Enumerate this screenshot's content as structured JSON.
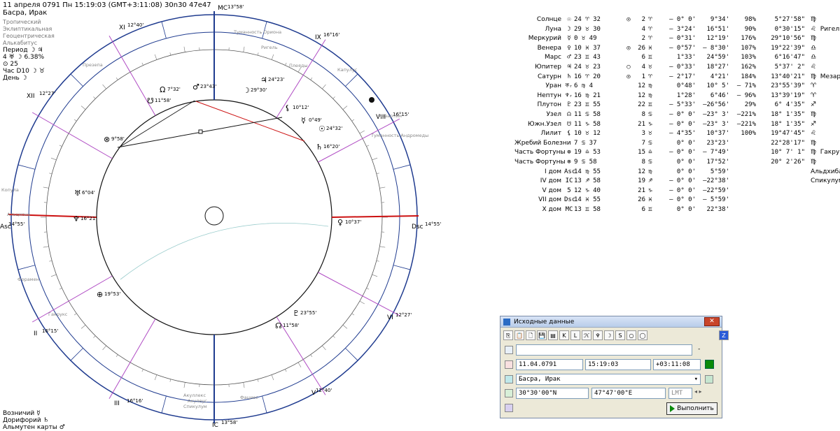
{
  "header": {
    "line1": "11 апреля 0791  Пн  15:19:03 (GMT+3:11:08) 30n30  47e47",
    "line2": "Басра, Ирак"
  },
  "info": {
    "zodiac": "Тропический",
    "coords": "Эклиптикальная",
    "center": "Геоцентрическая",
    "house": "Алькабитус",
    "period_label": "Период",
    "period_glyphs": "☽ ♃",
    "phase_line": "4 ♅ ☽ 6.38%",
    "day_num_line": "⊙ 25",
    "hour_label": "Час D10",
    "hour_glyphs": "☽ ♉",
    "day_label": "День",
    "day_glyph": "☽"
  },
  "bottom": {
    "vozn": "Возничий ☿",
    "dorif": "Дорифорий ♄",
    "almuten": "Альмутен карты ♂"
  },
  "chart_labels": {
    "mc": "MC",
    "mc_deg": "13°58'",
    "ic": "IC",
    "ic_deg": "13°58'",
    "asc": "Asc",
    "asc_deg": "14°55'",
    "dsc": "Dsc",
    "dsc_deg": "14°55'",
    "cusps": [
      {
        "name": "XI",
        "deg": "12°40'"
      },
      {
        "name": "XII",
        "deg": "12°27'"
      },
      {
        "name": "IX",
        "deg": "16°16'"
      },
      {
        "name": "VIII",
        "deg": "16°15'"
      },
      {
        "name": "II",
        "deg": "16°15'"
      },
      {
        "name": "III",
        "deg": "16°16'"
      },
      {
        "name": "VI",
        "deg": "12°27'"
      },
      {
        "name": "V",
        "deg": "12°40'"
      }
    ],
    "stars": [
      "Туманность Ориона",
      "Ригель",
      "Плеяды",
      "Капулус",
      "Мезартим",
      "Туманность Андромеды",
      "Копула",
      "Альциона",
      "Форамен",
      "Гакрукс",
      "Акуллекс",
      "Акулеус",
      "Спикулум",
      "Фациес",
      "Презепа",
      "Альдхиба"
    ],
    "planets": [
      {
        "g": "☉",
        "deg": "24°32'"
      },
      {
        "g": "☽",
        "deg": "29°30'"
      },
      {
        "g": "☿",
        "deg": "0°49'"
      },
      {
        "g": "♀",
        "deg": "10°37'"
      },
      {
        "g": "♂",
        "deg": "23°43'"
      },
      {
        "g": "♃",
        "deg": "24°23'"
      },
      {
        "g": "♄",
        "deg": "16°20'"
      },
      {
        "g": "♅",
        "deg": "6°04'"
      },
      {
        "g": "♆",
        "deg": "16°21'"
      },
      {
        "g": "♇",
        "deg": "23°55'"
      },
      {
        "g": "☊",
        "deg": "11°58'"
      },
      {
        "g": "☋",
        "deg": "11°58'"
      },
      {
        "g": "⚸",
        "deg": "10°12'"
      },
      {
        "g": "⊗",
        "deg": "9°58'"
      },
      {
        "g": "⊕",
        "deg": "19°53'"
      },
      {
        "g": "Ω",
        "deg": "7°32'"
      }
    ]
  },
  "table": {
    "rows": [
      {
        "name": "Солнце",
        "sym": "☉",
        "pos": "24 ♈ 32",
        "g1": "◎",
        "h": "2",
        "g2": "♈",
        "lat": "– 0° 0'",
        "speed": "9°34'",
        "pct": "98%",
        "dec": "5°27'58\"",
        "star": "♍"
      },
      {
        "name": "Луна",
        "sym": "☽",
        "pos": "29 ♉ 30",
        "g1": "",
        "h": "4",
        "g2": "♈",
        "lat": "– 3°24'",
        "speed": "16°51'",
        "pct": "90%",
        "dec": "0°30'15\"",
        "star": "♌  Ригель"
      },
      {
        "name": "Меркурий",
        "sym": "☿",
        "pos": "0 ♉ 49",
        "g1": "",
        "h": "2",
        "g2": "♈",
        "lat": "– 0°31'",
        "speed": "12°19'",
        "pct": "176%",
        "dec": "29°10'56\"",
        "star": "♍"
      },
      {
        "name": "Венера",
        "sym": "♀",
        "pos": "10 ♓ 37",
        "g1": "◎",
        "h": "26",
        "g2": "♓",
        "lat": "– 0°57'",
        "speed": "– 8°30'",
        "pct": "107%",
        "dec": "19°22'39\"",
        "star": "♎"
      },
      {
        "name": "Марс",
        "sym": "♂",
        "pos": "23 ♊ 43",
        "g1": "",
        "h": "6",
        "g2": "♊",
        "lat": "1°33'",
        "speed": "24°59'",
        "pct": "103%",
        "dec": "6°16'47\"",
        "star": "♎"
      },
      {
        "name": "Юпитер",
        "sym": "♃",
        "pos": "24 ♉ 23",
        "g1": "○",
        "h": "4",
        "g2": "♉",
        "lat": "– 0°33'",
        "speed": "18°27'",
        "pct": "162%",
        "dec": "5°37' 2\"",
        "star": "♌"
      },
      {
        "name": "Сатурн",
        "sym": "♄",
        "pos": "16 ♈ 20",
        "g1": "◎",
        "h": "1",
        "g2": "♈",
        "lat": "– 2°17'",
        "speed": "4°21'",
        "pct": "184%",
        "dec": "13°40'21\"",
        "star": "♍  Мезартим"
      },
      {
        "name": "Уран",
        "sym": "♅ᵣ",
        "pos": "6 ♍ 4",
        "g1": "",
        "h": "12",
        "g2": "♍",
        "lat": "0°48'",
        "speed": "10° 5'",
        "pct": "– 71%",
        "dec": "23°55'39\"",
        "star": "♈"
      },
      {
        "name": "Нептун",
        "sym": "♆ᵣ",
        "pos": "16 ♍ 21",
        "g1": "",
        "h": "12",
        "g2": "♍",
        "lat": "1°28'",
        "speed": "6°46'",
        "pct": "– 96%",
        "dec": "13°39'19\"",
        "star": "♈"
      },
      {
        "name": "Плутон",
        "sym": "♇",
        "pos": "23 ♊ 55",
        "g1": "",
        "h": "22",
        "g2": "♊",
        "lat": "– 5°33'",
        "speed": "–26°56'",
        "pct": "29%",
        "dec": "6° 4'35\"",
        "star": "♐"
      },
      {
        "name": "Узел",
        "sym": "☊",
        "pos": "11 ♋ 58",
        "g1": "",
        "h": "8",
        "g2": "♋",
        "lat": "– 0° 0'",
        "speed": "–23° 3'",
        "pct": "–221%",
        "dec": "18° 1'35\"",
        "star": "♍"
      },
      {
        "name": "Южн.Узел",
        "sym": "☋",
        "pos": "11 ♑ 58",
        "g1": "",
        "h": "21",
        "g2": "♑",
        "lat": "– 0° 0'",
        "speed": "–23° 3'",
        "pct": "–221%",
        "dec": "18° 1'35\"",
        "star": "♐"
      },
      {
        "name": "Лилит",
        "sym": "⚸",
        "pos": "10 ♉ 12",
        "g1": "",
        "h": "3",
        "g2": "♉",
        "lat": "– 4°35'",
        "speed": "10°37'",
        "pct": "100%",
        "dec": "19°47'45\"",
        "star": "♌"
      },
      {
        "name": "Жребий Болезни",
        "sym": "",
        "pos": "7 ♋ 37",
        "g1": "",
        "h": "7",
        "g2": "♋",
        "lat": "0° 0'",
        "speed": "23°23'",
        "pct": "",
        "dec": "22°28'17\"",
        "star": "♍"
      },
      {
        "name": "Часть Фортуны",
        "sym": "⊕",
        "pos": "19 ♎ 53",
        "g1": "",
        "h": "15",
        "g2": "♎",
        "lat": "– 0° 0'",
        "speed": "– 7°49'",
        "pct": "",
        "dec": "10° 7' 1\"",
        "star": "♍  Гакрукс"
      },
      {
        "name": "Часть Фортуны",
        "sym": "⊗",
        "pos": "9 ♋ 58",
        "g1": "",
        "h": "8",
        "g2": "♋",
        "lat": "0° 0'",
        "speed": "17°52'",
        "pct": "",
        "dec": "20° 2'26\"",
        "star": "♍"
      },
      {
        "name": "I дом",
        "sym": "Asc",
        "pos": "14 ♍ 55",
        "g1": "",
        "h": "12",
        "g2": "♍",
        "lat": "0° 0'",
        "speed": "5°59'",
        "pct": "",
        "dec": "",
        "star": "Альдхиба"
      },
      {
        "name": "IV дом",
        "sym": "IC",
        "pos": "13 ♐ 58",
        "g1": "",
        "h": "19",
        "g2": "♐",
        "lat": "– 0° 0'",
        "speed": "–22°38'",
        "pct": "",
        "dec": "",
        "star": "Спикулум"
      },
      {
        "name": "V дом",
        "sym": "5",
        "pos": "12 ♑ 40",
        "g1": "",
        "h": "21",
        "g2": "♑",
        "lat": "– 0° 0'",
        "speed": "–22°59'",
        "pct": "",
        "dec": "",
        "star": ""
      },
      {
        "name": "VII дом",
        "sym": "Dsc",
        "pos": "14 ♓ 55",
        "g1": "",
        "h": "26",
        "g2": "♓",
        "lat": "– 0° 0'",
        "speed": "– 5°59'",
        "pct": "",
        "dec": "",
        "star": ""
      },
      {
        "name": "X дом",
        "sym": "MC",
        "pos": "13 ♊ 58",
        "g1": "",
        "h": "6",
        "g2": "♊",
        "lat": "0° 0'",
        "speed": "22°38'",
        "pct": "",
        "dec": "",
        "star": ""
      }
    ]
  },
  "dialog": {
    "title": "Исходные данные",
    "close": "✕",
    "toolbar": [
      "⎘",
      "📋",
      "🗋",
      "💾",
      "▤",
      "K",
      "L",
      "ℋ",
      "♆",
      "☽",
      "S",
      "○",
      "◯",
      "Z"
    ],
    "date": "11.04.0791",
    "time": "15:19:03",
    "tz": "+03:11:08",
    "place": "Басра, Ирак",
    "lat": "30°30'00\"N",
    "lon": "47°47'00\"E",
    "lmt": "LMT",
    "run": "Выполнить",
    "top_combo": "",
    "top_combo_right": "-"
  },
  "colors": {
    "red": "#cc1111",
    "blue": "#1f3b8f",
    "magenta": "#b04cc4",
    "cyan": "#29b5d8",
    "green": "#0a8a0a"
  }
}
